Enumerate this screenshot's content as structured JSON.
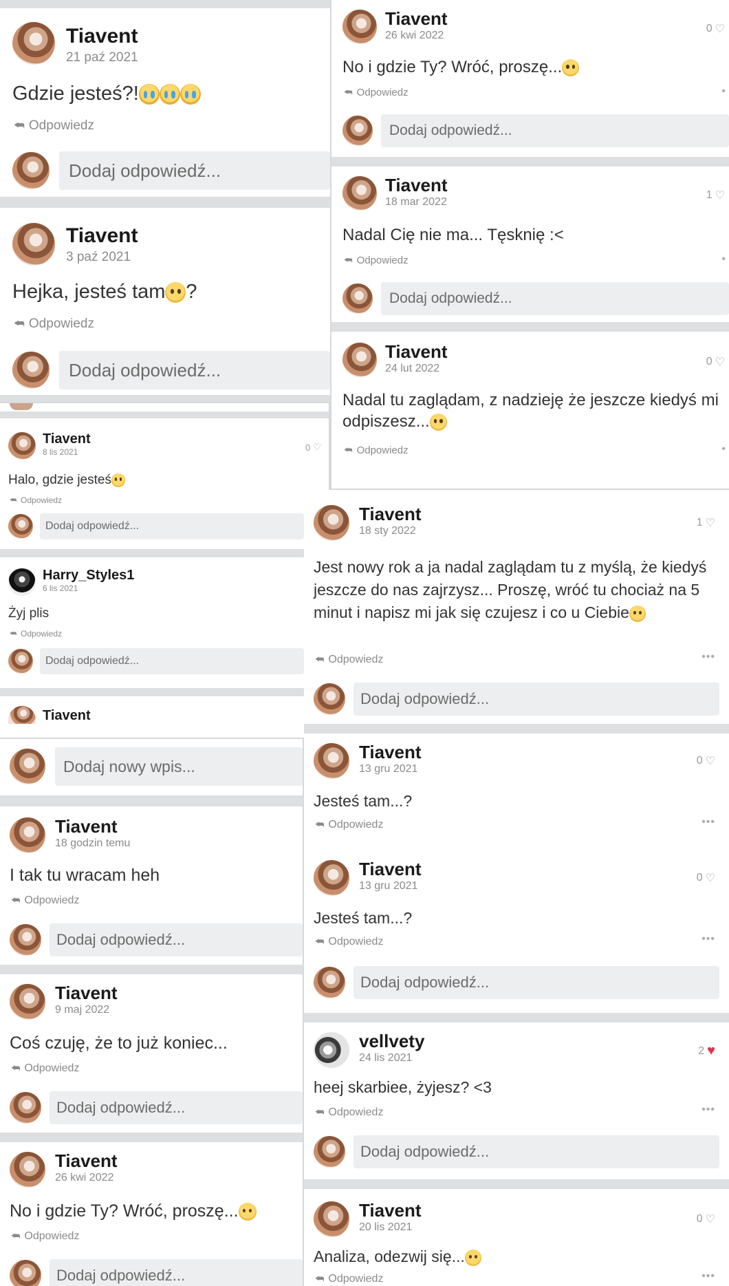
{
  "labels": {
    "reply": "Odpowiedz",
    "add_reply": "Dodaj odpowiedź...",
    "add_post": "Dodaj nowy wpis..."
  },
  "panel_a": {
    "posts": [
      {
        "user": "Tiavent",
        "date": "21 paź 2021",
        "text": "Gdzie jesteś?!"
      },
      {
        "user": "Tiavent",
        "date": "3 paź 2021",
        "text": "Hejka, jesteś tam",
        "text_after": "?"
      }
    ]
  },
  "panel_b": {
    "posts": [
      {
        "user": "Tiavent",
        "date": "26 kwi 2022",
        "likes": "0",
        "text": "No i gdzie Ty? Wróć, proszę..."
      },
      {
        "user": "Tiavent",
        "date": "18 mar 2022",
        "likes": "1",
        "text": "Nadal Cię nie ma... Tęsknię :<"
      },
      {
        "user": "Tiavent",
        "date": "24 lut 2022",
        "likes": "0",
        "text": "Nadal tu zaglądam, z nadzieję że jeszcze kiedyś mi odpiszesz..."
      }
    ]
  },
  "panel_c": {
    "posts": [
      {
        "user": "Tiavent",
        "date": "8 lis 2021",
        "likes": "0",
        "text": "Halo, gdzie jesteś"
      },
      {
        "user": "Harry_Styles1",
        "date": "6 lis 2021",
        "text": "Żyj plis"
      }
    ],
    "footer_user": "Tiavent"
  },
  "panel_d": {
    "posts": [
      {
        "user": "Tiavent",
        "date": "18 godzin temu",
        "text": "I tak tu wracam heh"
      },
      {
        "user": "Tiavent",
        "date": "9 maj 2022",
        "text": "Coś czuję, że to już koniec..."
      },
      {
        "user": "Tiavent",
        "date": "26 kwi 2022",
        "text": "No i gdzie Ty? Wróć, proszę..."
      }
    ]
  },
  "panel_e": {
    "posts": [
      {
        "user": "Tiavent",
        "date": "18 sty 2022",
        "likes": "1",
        "text": "Jest nowy rok a ja nadal zaglądam tu z myślą, że kiedyś jeszcze do nas zajrzysz... Proszę, wróć tu chociaż na 5 minut i napisz mi jak się czujesz i co u Ciebie"
      },
      {
        "user": "Tiavent",
        "date": "13 gru 2021",
        "likes": "0",
        "text": "Jesteś tam...?"
      },
      {
        "user": "Tiavent",
        "date": "13 gru 2021",
        "likes": "0",
        "text": "Jesteś tam...?"
      },
      {
        "user": "vellvety",
        "date": "24 lis 2021",
        "likes": "2",
        "text": "heej skarbiee, żyjesz? <3"
      },
      {
        "user": "Tiavent",
        "date": "20 lis 2021",
        "likes": "0",
        "text": "Analiza, odezwij się..."
      }
    ]
  },
  "icons": {
    "reply": "reply-arrow-icon",
    "like": "heart-icon",
    "more": "more-dots-icon",
    "emoji_cry": "crying-face-emoji",
    "emoji_plead": "pleading-face-emoji"
  },
  "colors": {
    "like_active": "#e0344e",
    "input_bg": "#eceeef",
    "separator": "#dedfe1"
  }
}
